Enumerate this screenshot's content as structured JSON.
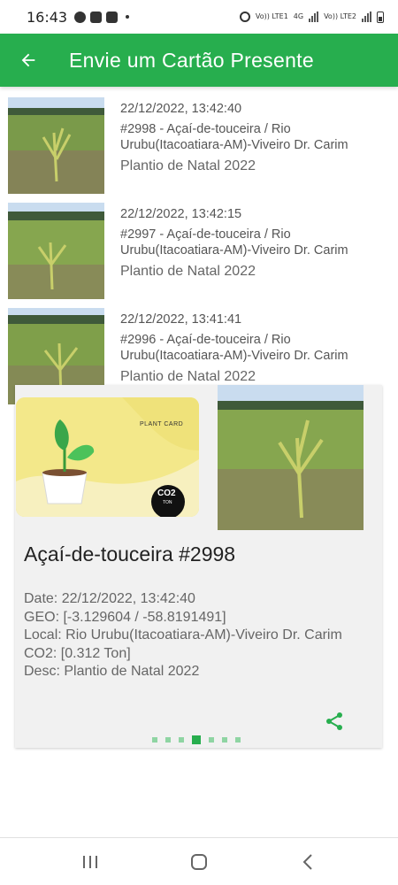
{
  "status_bar": {
    "time": "16:43",
    "sim1_label": "Vo)) LTE1",
    "sim1_net": "4G",
    "sim2_label": "Vo)) LTE2"
  },
  "app_bar": {
    "title": "Envie um Cartão Presente"
  },
  "list": {
    "items": [
      {
        "date": "22/12/2022, 13:42:40",
        "title": "#2998 - Açaí-de-touceira / Rio Urubu(Itacoatiara-AM)-Viveiro Dr. Carim",
        "subtitle": "Plantio de Natal 2022"
      },
      {
        "date": "22/12/2022, 13:42:15",
        "title": "#2997 - Açaí-de-touceira / Rio Urubu(Itacoatiara-AM)-Viveiro Dr. Carim",
        "subtitle": "Plantio de Natal 2022"
      },
      {
        "date": "22/12/2022, 13:41:41",
        "title": "#2996 - Açaí-de-touceira / Rio Urubu(Itacoatiara-AM)-Viveiro Dr. Carim",
        "subtitle": "Plantio de Natal 2022"
      }
    ]
  },
  "card": {
    "plant_card_label": "PLANT CARD",
    "co2_label": "CO2",
    "co2_unit": "TON",
    "title": "Açaí-de-touceira #2998",
    "date_line": "Date: 22/12/2022, 13:42:40",
    "geo_line": "GEO: [-3.129604 / -58.8191491]",
    "local_line": "Local: Rio Urubu(Itacoatiara-AM)-Viveiro Dr. Carim",
    "co2_line": "CO2: [0.312 Ton]",
    "desc_line": "Desc: Plantio de Natal 2022",
    "dots_count": 7,
    "active_dot": 3
  },
  "colors": {
    "primary_green": "#27ae4e",
    "dot_inactive": "#8fd5a3",
    "card_background": "#f1f1f1"
  },
  "icons": {
    "back": "arrow-left-icon",
    "share": "share-icon",
    "nav_recents": "recents-icon",
    "nav_home": "home-icon",
    "nav_back": "nav-back-icon"
  }
}
